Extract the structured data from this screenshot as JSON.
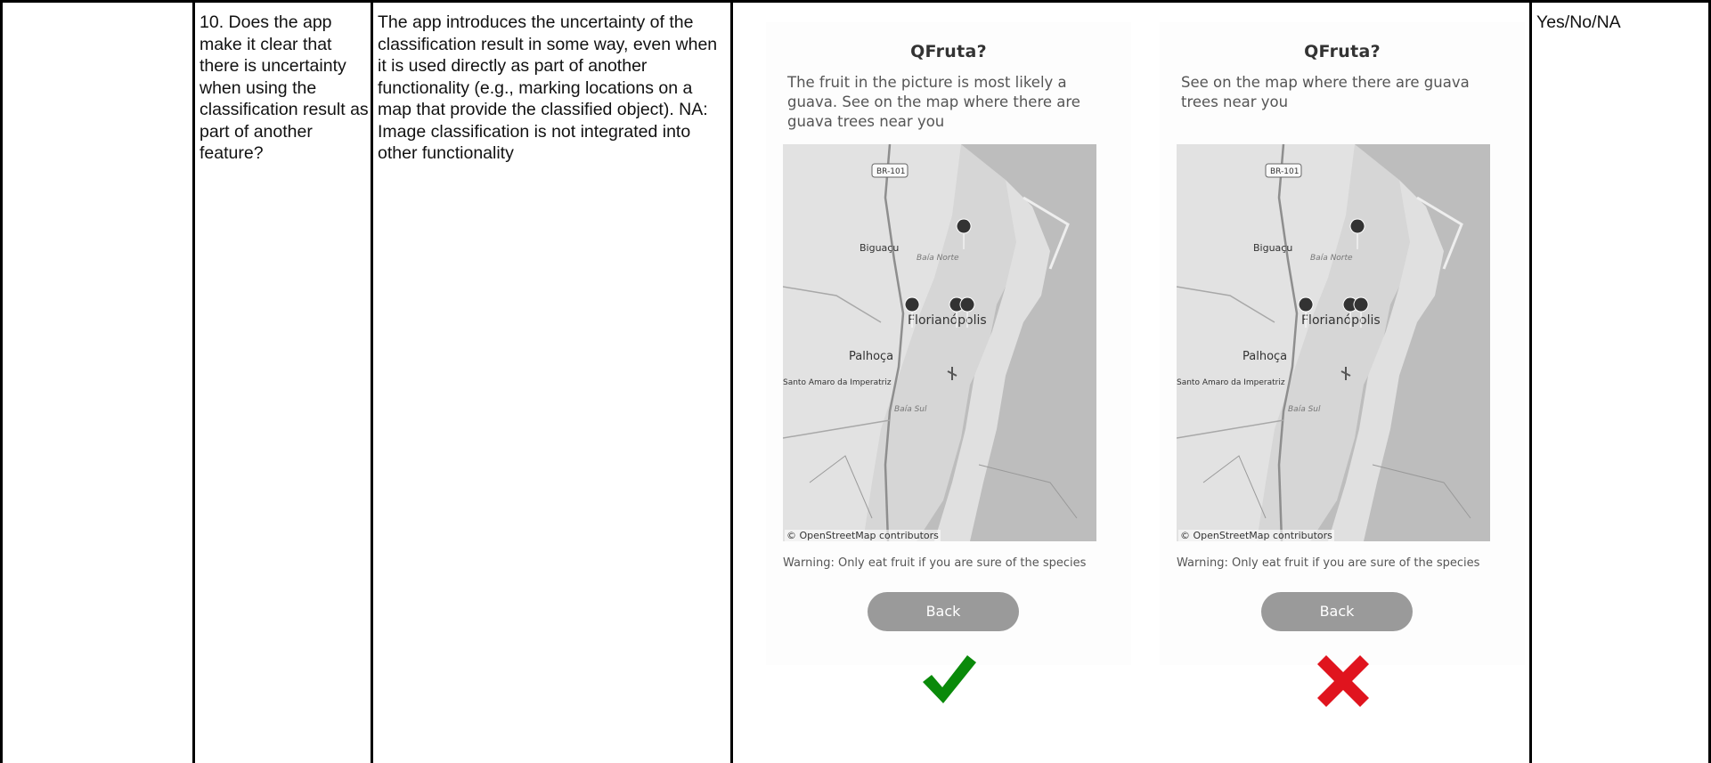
{
  "row": {
    "question": "10. Does the app make it clear that there is uncertainty when using the classification result as part of another feature?",
    "description": "The app introduces the uncertainty of the classification result in some way, even when it is used directly as part of another functionality (e.g., marking locations on a map that provide the classified object). NA: Image classification is not integrated into other functionality",
    "answer_options": "Yes/No/NA"
  },
  "examples": [
    {
      "app_title": "QFruta?",
      "message": "The fruit in the picture is most likely a guava. See on the map where there are guava trees near you",
      "map_labels": [
        "BR-101",
        "Biguaçu",
        "Baía Norte",
        "Florianópolis",
        "Palhoça",
        "Santo Amaro da Imperatriz",
        "Baía Sul"
      ],
      "map_credit": "© OpenStreetMap contributors",
      "warning": "Warning: Only eat fruit if you are sure of the species",
      "back_label": "Back",
      "verdict": "correct",
      "verdict_icon": "check-mark-icon",
      "verdict_color": "#0a8a0a"
    },
    {
      "app_title": "QFruta?",
      "message": "See on the map where there are guava trees near you",
      "map_labels": [
        "BR-101",
        "Biguaçu",
        "Baía Norte",
        "Florianópolis",
        "Palhoça",
        "Santo Amaro da Imperatriz",
        "Baía Sul"
      ],
      "map_credit": "© OpenStreetMap contributors",
      "warning": "Warning: Only eat fruit if you are sure of the species",
      "back_label": "Back",
      "verdict": "incorrect",
      "verdict_icon": "cross-mark-icon",
      "verdict_color": "#e0141e"
    }
  ]
}
